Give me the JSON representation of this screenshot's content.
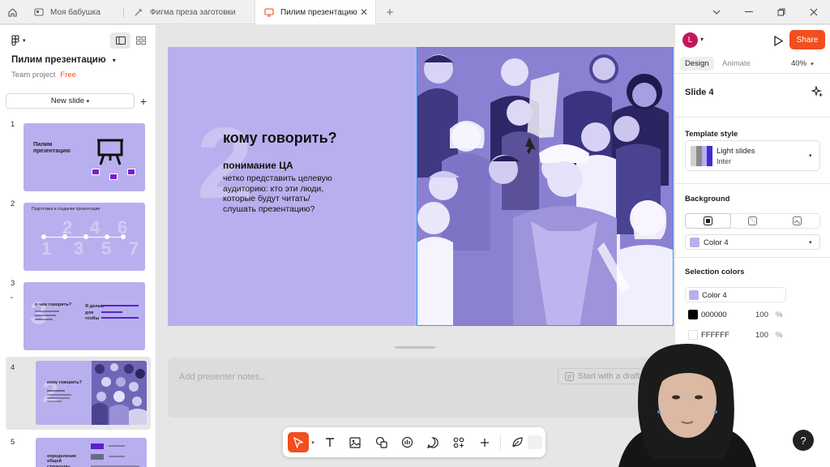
{
  "tabs": [
    {
      "label": "Моя бабушка",
      "icon": "board-icon",
      "active": false
    },
    {
      "label": "Фигма преза заготовки",
      "icon": "design-file-icon",
      "active": false
    },
    {
      "label": "Пилим презентацию",
      "icon": "slides-file-icon",
      "active": true
    }
  ],
  "project": {
    "title": "Пилим презентацию",
    "team": "Team project",
    "plan": "Free"
  },
  "left_panel": {
    "new_slide_label": "New slide"
  },
  "thumbnails": [
    {
      "num": "1",
      "title": "Пилим презентацию"
    },
    {
      "num": "2",
      "title": "Подготовка и создание презентации"
    },
    {
      "num": "3",
      "title": "о чем говорить?",
      "text2": "Я делаю",
      "text3": "для",
      "text4": "чтобы"
    },
    {
      "num": "4",
      "title": "кому говорить?",
      "selected": true
    },
    {
      "num": "5",
      "title": "определение общей структуры"
    }
  ],
  "slide": {
    "number": "2",
    "title": "кому говорить?",
    "subtitle": "понимание ЦА",
    "body": "четко представить целевую аудиторию: кто эти люди, которые будут читать/слушать презентацию?",
    "bg_color": "#b8b0ee"
  },
  "notes": {
    "placeholder": "Add presenter notes...",
    "draft_label": "Start with a draft"
  },
  "toolbar": {
    "tools": [
      "move",
      "text",
      "image",
      "shapes",
      "stamp",
      "comment",
      "widgets",
      "add",
      "dev-mode"
    ]
  },
  "right_panel": {
    "avatar_letter": "L",
    "share_label": "Share",
    "tab_design": "Design",
    "tab_animate": "Animate",
    "zoom": "40%",
    "slide_name": "Slide 4",
    "template_style_title": "Template style",
    "template_name": "Light slides",
    "template_font": "Inter",
    "background_title": "Background",
    "background_color": "Color 4",
    "selection_colors_title": "Selection colors",
    "selection_colors": [
      {
        "name": "Color 4",
        "hex": "#b8b0ee"
      },
      {
        "name": "000000",
        "hex": "#000000",
        "opacity": "100",
        "unit": "%"
      },
      {
        "name": "FFFFFF",
        "hex": "#ffffff",
        "opacity": "100",
        "unit": "%"
      }
    ]
  },
  "colors": {
    "accent": "#f24e1e",
    "selection": "#18a0fb",
    "slide_bg": "#b8b0ee"
  }
}
